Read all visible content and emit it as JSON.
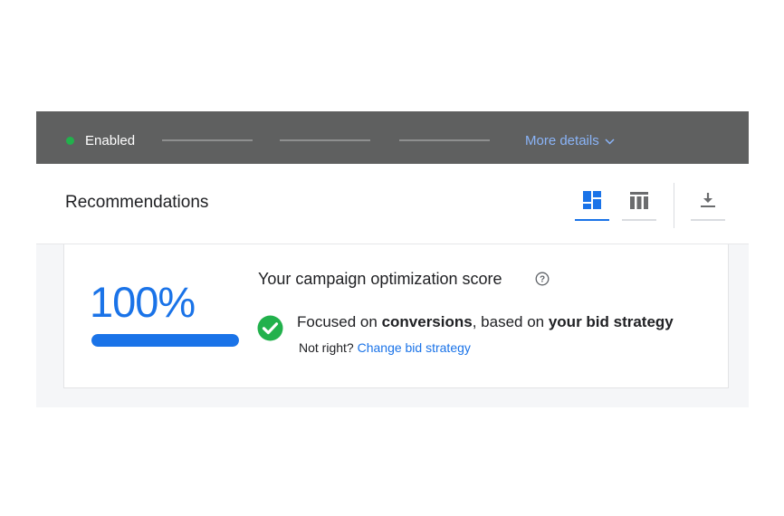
{
  "status": {
    "state": "Enabled",
    "state_color": "#22b14c",
    "more_details": "More details",
    "more_details_icon": "chevron-down-icon"
  },
  "toolbar": {
    "title": "Recommendations",
    "views": [
      {
        "icon": "card-view-icon",
        "active": true
      },
      {
        "icon": "table-view-icon",
        "active": false
      }
    ],
    "download_icon": "download-icon"
  },
  "optimization": {
    "score": "100%",
    "score_value": 100,
    "label": "Your campaign optimization score",
    "help_icon": "help-circle-icon",
    "status_icon": "check-circle-icon",
    "focus_prefix": "Focused on ",
    "focus_metric": "conversions",
    "focus_middle": ", based on ",
    "focus_source": "your bid strategy",
    "hint_prefix": "Not right?",
    "hint_link": "Change bid strategy"
  },
  "colors": {
    "accent": "#1a73e8",
    "success": "#22b14c",
    "header_bg": "#5f6060"
  }
}
